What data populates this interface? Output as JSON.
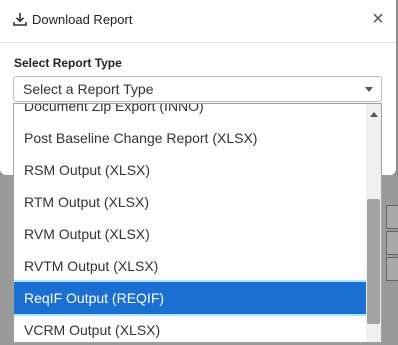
{
  "dialog": {
    "title": "Download Report",
    "close_symbol": "×",
    "field_label": "Select Report Type",
    "select_placeholder": "Select a Report Type"
  },
  "options": [
    "Document Zip Export (INNO)",
    "Post Baseline Change Report (XLSX)",
    "RSM Output (XLSX)",
    "RTM Output (XLSX)",
    "RVM Output (XLSX)",
    "RVTM Output (XLSX)",
    "ReqIF Output (REQIF)",
    "VCRM Output (XLSX)"
  ],
  "selected_option": "ReqIF Output (REQIF)",
  "colors": {
    "selected_bg": "#1b6fd2",
    "selected_text": "#ffffff"
  },
  "icons": {
    "title": "download-icon",
    "close": "close-icon",
    "caret": "chevron-down-icon"
  }
}
